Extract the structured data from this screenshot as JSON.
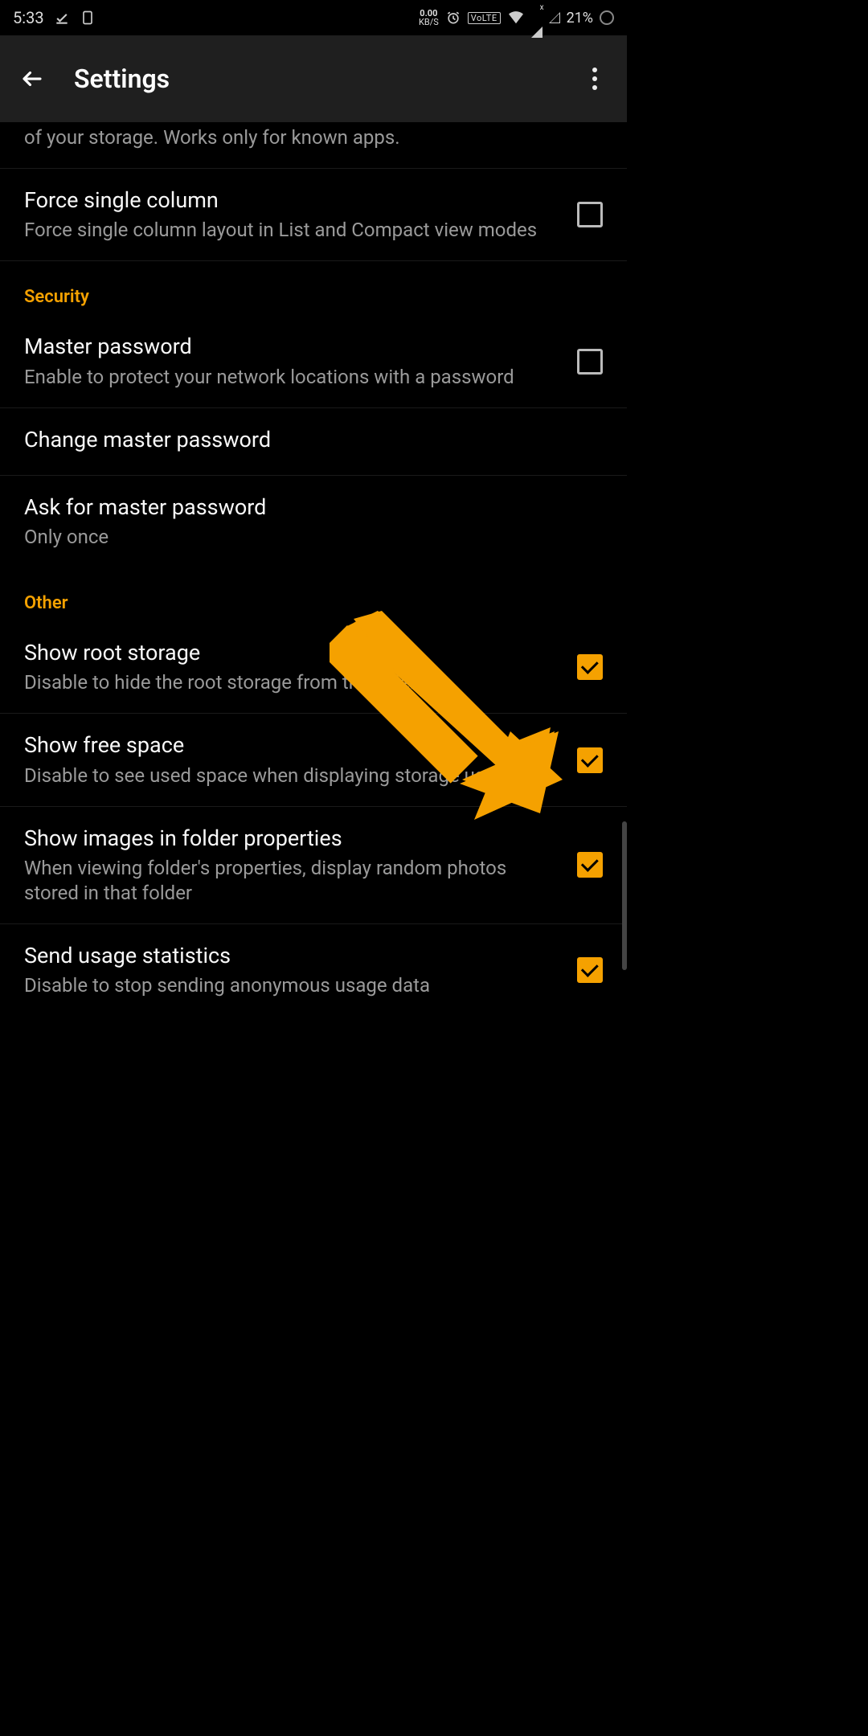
{
  "status": {
    "time": "5:33",
    "net_speed_top": "0.00",
    "net_speed_bot": "KB/S",
    "volte": "VoLTE",
    "battery": "21%"
  },
  "appbar": {
    "title": "Settings"
  },
  "partial_top_sub": "of your storage. Works only for known apps.",
  "rows": {
    "force_single": {
      "title": "Force single column",
      "sub": "Force single column layout in List and Compact view modes",
      "checked": false
    },
    "security_header": "Security",
    "master_pw": {
      "title": "Master password",
      "sub": "Enable to protect your network locations with a password",
      "checked": false
    },
    "change_master": {
      "title": "Change master password"
    },
    "ask_master": {
      "title": "Ask for master password",
      "sub": "Only once"
    },
    "other_header": "Other",
    "show_root": {
      "title": "Show root storage",
      "sub": "Disable to hide the root storage from the sidebar",
      "checked": true
    },
    "show_free": {
      "title": "Show free space",
      "sub": "Disable to see used space when displaying storage usage",
      "checked": true
    },
    "show_images": {
      "title": "Show images in folder properties",
      "sub": "When viewing folder's properties, display random photos stored in that folder",
      "checked": true
    },
    "usage_stats": {
      "title": "Send usage statistics",
      "sub": "Disable to stop sending anonymous usage data",
      "checked": true
    }
  },
  "colors": {
    "accent": "#f5a100"
  }
}
